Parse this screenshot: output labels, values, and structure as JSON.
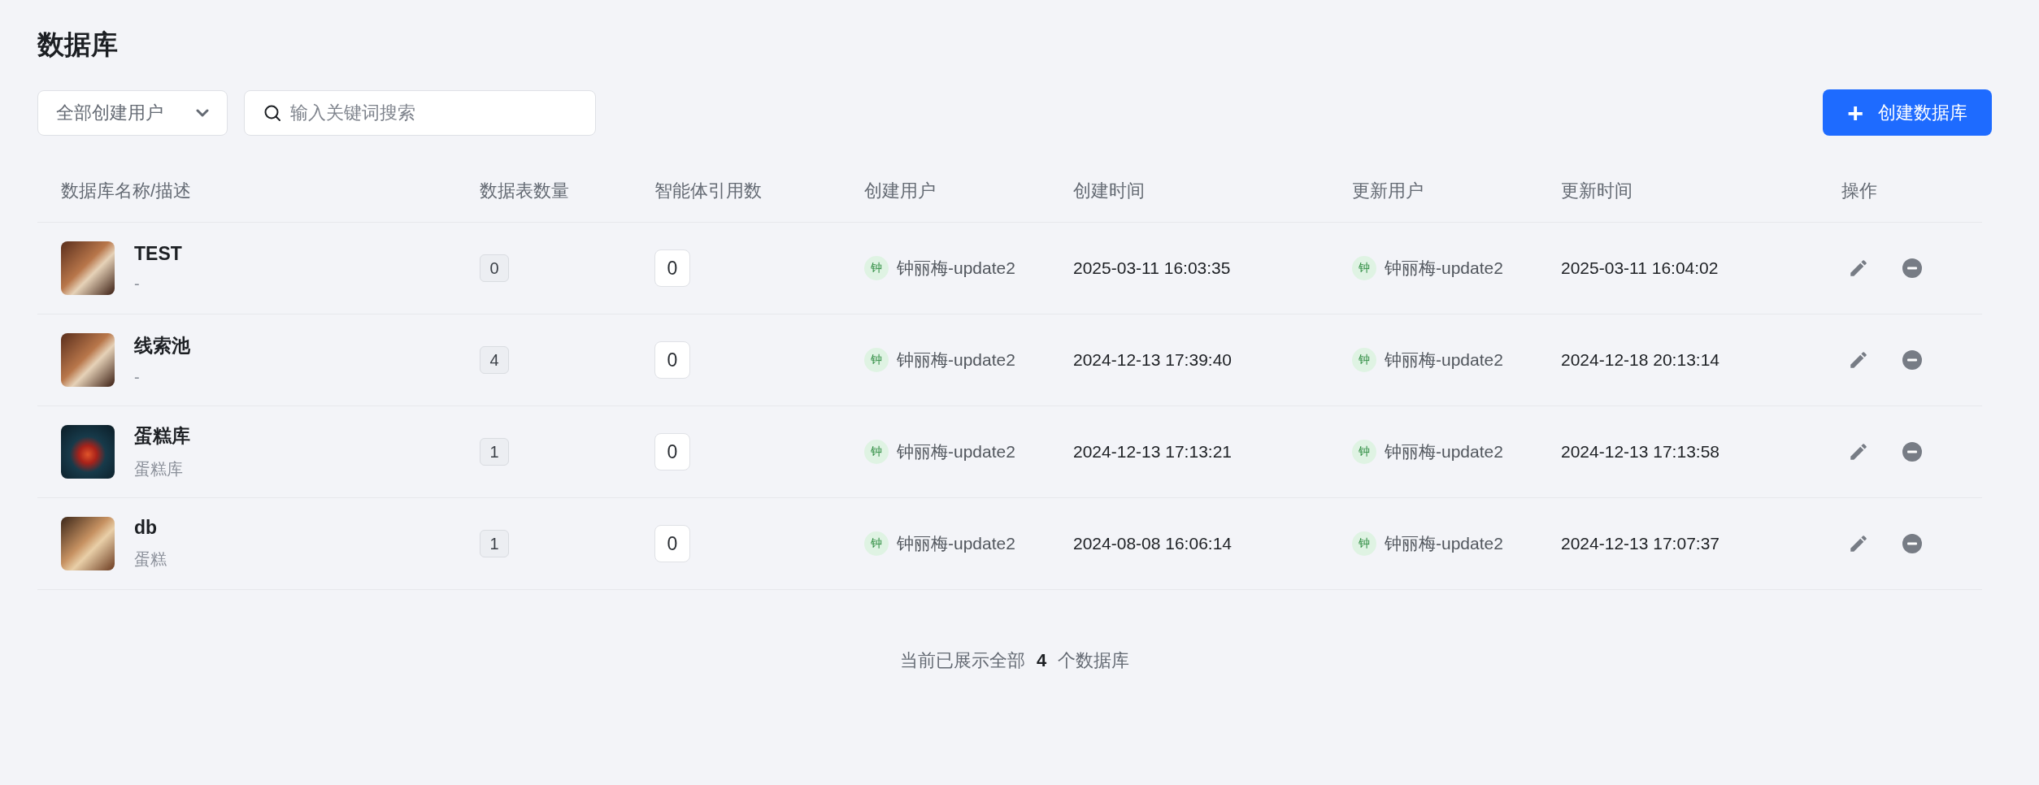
{
  "page_title": "数据库",
  "filter": {
    "label": "全部创建用户"
  },
  "search": {
    "placeholder": "输入关键词搜索"
  },
  "create_button": {
    "icon": "+",
    "label": "创建数据库"
  },
  "table": {
    "columns": [
      "数据库名称/描述",
      "数据表数量",
      "智能体引用数",
      "创建用户",
      "创建时间",
      "更新用户",
      "更新时间",
      "操作"
    ],
    "rows": [
      {
        "name": "TEST",
        "description": "-",
        "tables": "0",
        "agent_refs": "0",
        "creator_avatar": "钟",
        "creator": "钟丽梅-update2",
        "created": "2025-03-11 16:03:35",
        "updater_avatar": "钟",
        "updater": "钟丽梅-update2",
        "updated": "2025-03-11 16:04:02"
      },
      {
        "name": "线索池",
        "description": "-",
        "tables": "4",
        "agent_refs": "0",
        "creator_avatar": "钟",
        "creator": "钟丽梅-update2",
        "created": "2024-12-13 17:39:40",
        "updater_avatar": "钟",
        "updater": "钟丽梅-update2",
        "updated": "2024-12-18 20:13:14"
      },
      {
        "name": "蛋糕库",
        "description": "蛋糕库",
        "tables": "1",
        "agent_refs": "0",
        "creator_avatar": "钟",
        "creator": "钟丽梅-update2",
        "created": "2024-12-13 17:13:21",
        "updater_avatar": "钟",
        "updater": "钟丽梅-update2",
        "updated": "2024-12-13 17:13:58"
      },
      {
        "name": "db",
        "description": "蛋糕",
        "tables": "1",
        "agent_refs": "0",
        "creator_avatar": "钟",
        "creator": "钟丽梅-update2",
        "created": "2024-08-08 16:06:14",
        "updater_avatar": "钟",
        "updater": "钟丽梅-update2",
        "updated": "2024-12-13 17:07:37"
      }
    ]
  },
  "footer": "当前已展示全部 **4** 个数据库"
}
